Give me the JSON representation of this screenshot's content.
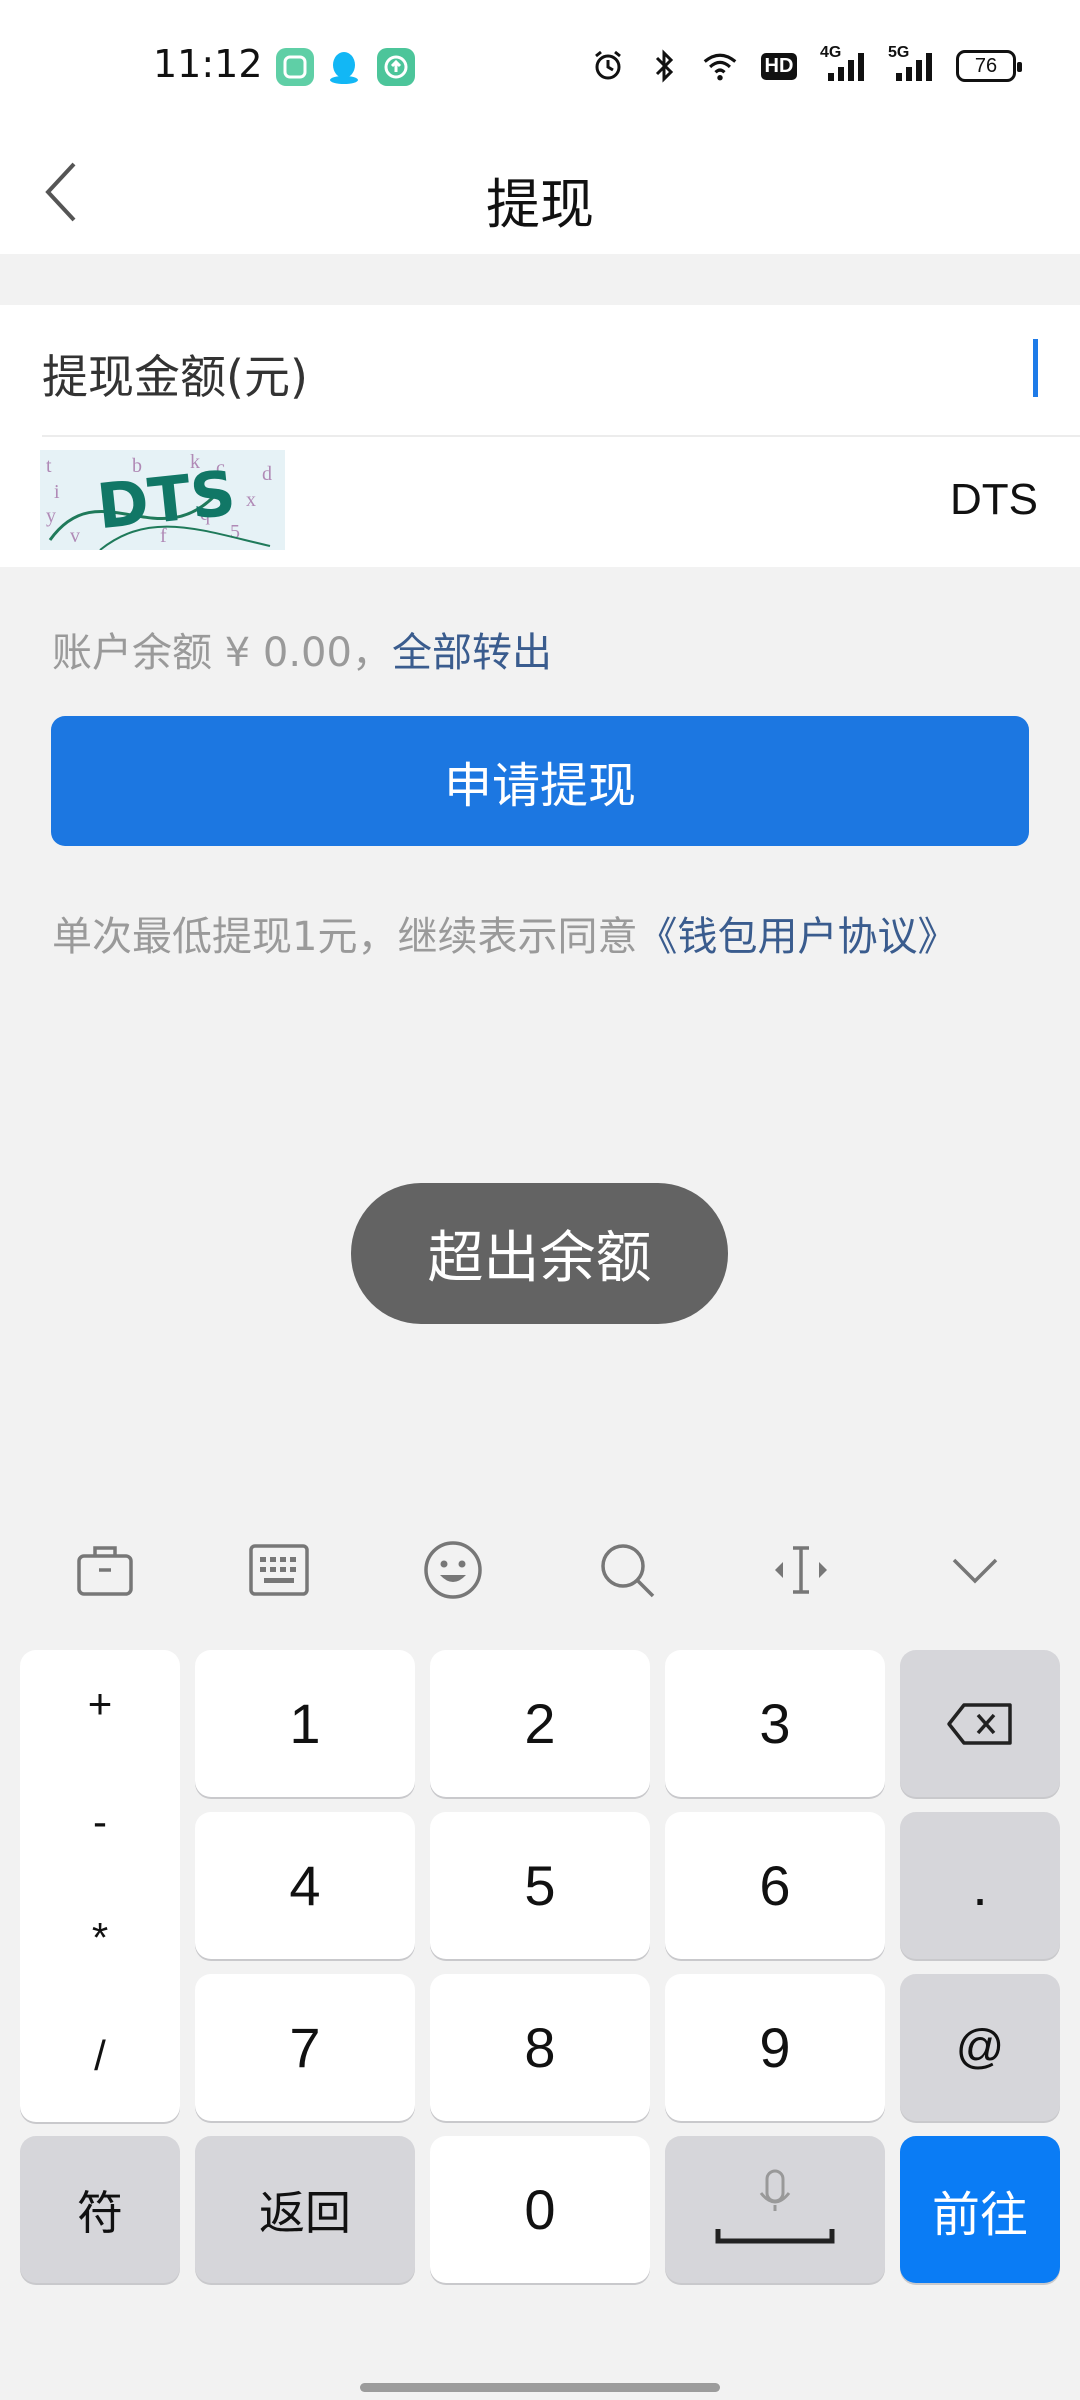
{
  "status_bar": {
    "time": "11:12",
    "battery": "76",
    "network_1": "4G",
    "network_2": "5G",
    "hd": "HD"
  },
  "header": {
    "title": "提现"
  },
  "form": {
    "amount_label": "提现金额(元)",
    "captcha_code": "DTS",
    "captcha_image_text": "DTS"
  },
  "balance": {
    "text": "账户余额 ¥ 0.00，",
    "link": "全部转出"
  },
  "submit_label": "申请提现",
  "agreement": {
    "text": "单次最低提现1元，继续表示同意",
    "link": "《钱包用户协议》"
  },
  "toast": "超出余额",
  "keyboard": {
    "symbols": [
      "+",
      "-",
      "*",
      "/"
    ],
    "digits": [
      "1",
      "2",
      "3",
      "4",
      "5",
      "6",
      "7",
      "8",
      "9",
      "0"
    ],
    "dot": ".",
    "at": "@",
    "fu": "符",
    "back": "返回",
    "go": "前往"
  },
  "colors": {
    "accent": "#1c77e1",
    "link": "#3a5c8e",
    "toast_bg": "#636363"
  }
}
